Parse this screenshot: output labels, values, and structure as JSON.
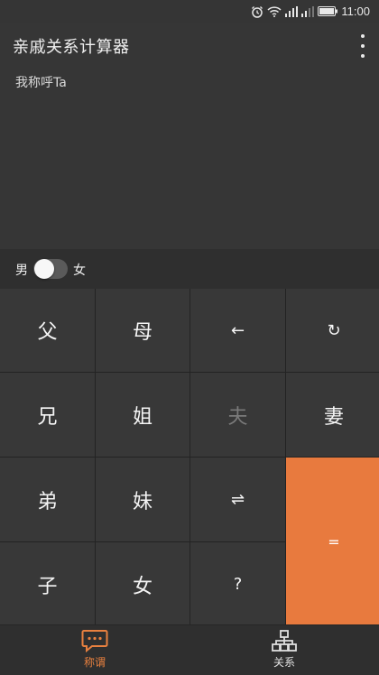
{
  "status": {
    "time": "11:00"
  },
  "app": {
    "title": "亲戚关系计算器"
  },
  "display": {
    "expression": "我称呼Ta"
  },
  "gender": {
    "male": "男",
    "female": "女"
  },
  "keys": {
    "father": "父",
    "mother": "母",
    "backspace": "←",
    "reset": "↻",
    "elder_brother": "兄",
    "elder_sister": "姐",
    "husband": "夫",
    "wife": "妻",
    "younger_brother": "弟",
    "younger_sister": "妹",
    "swap": "⇌",
    "son": "子",
    "daughter": "女",
    "question": "?",
    "equals": "="
  },
  "nav": {
    "address": "称谓",
    "relation": "关系",
    "active": "address"
  },
  "colors": {
    "accent": "#e87a3e",
    "background": "#363636",
    "key": "#383838"
  }
}
